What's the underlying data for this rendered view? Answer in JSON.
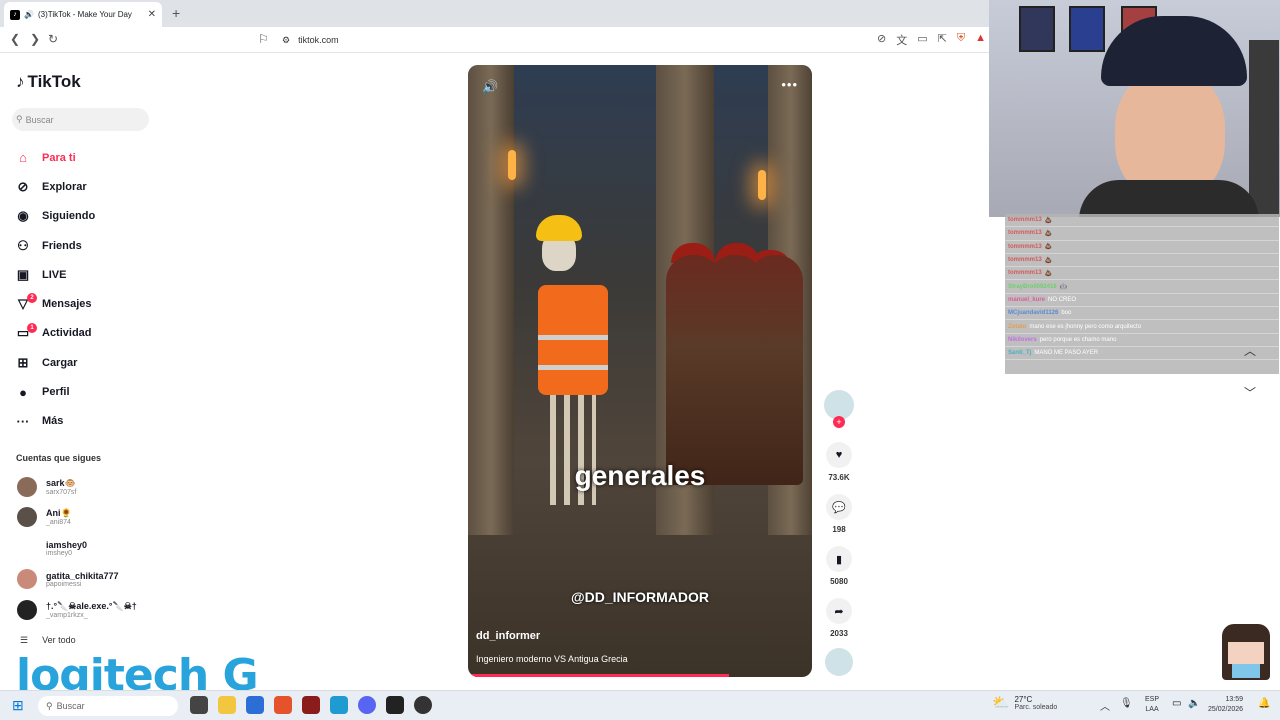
{
  "browser": {
    "tab_title": "(3)TikTok - Make Your Day",
    "tab_close": "✕",
    "new_tab": "+",
    "url": "tiktok.com"
  },
  "sidebar": {
    "logo": "TikTok",
    "search_placeholder": "Buscar",
    "items": [
      {
        "label": "Para ti",
        "icon": "⌂"
      },
      {
        "label": "Explorar",
        "icon": "⊘"
      },
      {
        "label": "Siguiendo",
        "icon": "◉"
      },
      {
        "label": "Friends",
        "icon": "⚇"
      },
      {
        "label": "LIVE",
        "icon": "▣"
      },
      {
        "label": "Mensajes",
        "icon": "▽",
        "badge": "2"
      },
      {
        "label": "Actividad",
        "icon": "▭",
        "badge": "1"
      },
      {
        "label": "Cargar",
        "icon": "⊞"
      },
      {
        "label": "Perfil",
        "icon": "●"
      },
      {
        "label": "Más",
        "icon": "···"
      }
    ],
    "following_title": "Cuentas que sigues",
    "following": [
      {
        "name": "sark🐵",
        "user": "sarx707sf"
      },
      {
        "name": "Ani🌻",
        "user": "_ani874"
      },
      {
        "name": "iamshey0",
        "user": "imshey0"
      },
      {
        "name": "gatita_chikita777",
        "user": "papoimessi"
      },
      {
        "name": "†.°🔪☠ale.exe.°🔪☠†",
        "user": "_vamp1rkzx_"
      }
    ],
    "see_all": "Ver todo"
  },
  "video": {
    "caption_overlay": "generales",
    "watermark": "@DD_INFORMADOR",
    "username": "dd_informer",
    "description": "Ingeniero moderno VS Antigua Grecia",
    "progress": 0.76
  },
  "actions": {
    "likes": "73.6K",
    "comments": "198",
    "saves": "5080",
    "shares": "2033"
  },
  "stream_chat": [
    {
      "name": "tommmm13",
      "msg": "💩"
    },
    {
      "name": "tommmm13",
      "msg": "💩"
    },
    {
      "name": "tommmm13",
      "msg": "💩"
    },
    {
      "name": "tommmm13",
      "msg": "💩"
    },
    {
      "name": "tommmm13",
      "msg": "💩"
    },
    {
      "name": "StrayBro0092416",
      "msg": "🤖"
    },
    {
      "name": "manuel_kure",
      "msg": "NO CREO"
    },
    {
      "name": "MCjuandavid1126",
      "msg": "boo"
    },
    {
      "name": "Zotato",
      "msg": "mano ese es jhonny pero como arquitecto"
    },
    {
      "name": "Nikilovers",
      "msg": "pero porque es chamo mano"
    },
    {
      "name": "Santi_Tj",
      "msg": "MANO ME PASO AYER"
    }
  ],
  "overlay_brand": "logitech G",
  "taskbar": {
    "search": "Buscar",
    "temp": "27°C",
    "weather": "Parc. soleado",
    "lang1": "ESP",
    "lang2": "LAA",
    "time": "13:59",
    "date": "25/02/2026"
  },
  "colors": {
    "accent": "#fe2c55"
  }
}
